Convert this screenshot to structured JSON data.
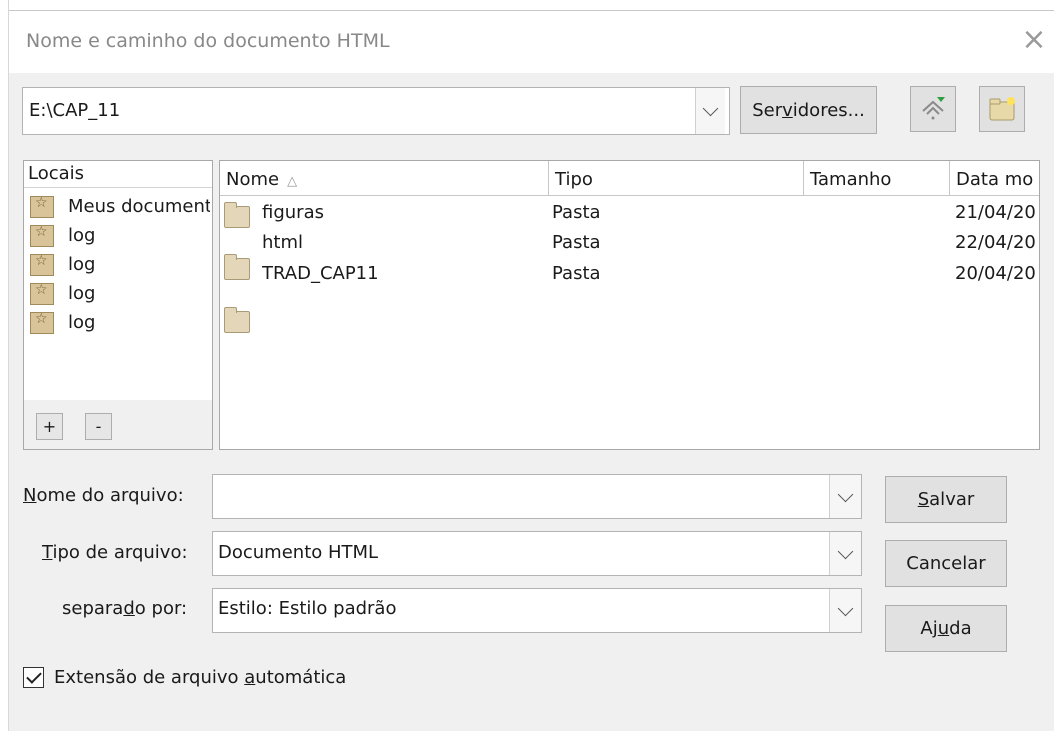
{
  "window": {
    "title": "Nome e caminho do documento HTML",
    "close_glyph": "×"
  },
  "path": {
    "value": "E:\\CAP_11"
  },
  "toolbar": {
    "servers_label": "Servidores...",
    "servers_label_pre": "Ser",
    "servers_label_mnemonic": "v",
    "servers_label_post": "idores...",
    "up_icon": "level-up-icon",
    "new_folder_icon": "new-folder-icon"
  },
  "places": {
    "header": "Locais",
    "items": [
      {
        "label": "Meus documentos"
      },
      {
        "label": "log"
      },
      {
        "label": "log"
      },
      {
        "label": "log"
      },
      {
        "label": "log"
      }
    ],
    "add_label": "+",
    "remove_label": "-"
  },
  "files": {
    "columns": [
      "Nome",
      "Tipo",
      "Tamanho",
      "Data mo"
    ],
    "sort_indicator": "△",
    "rows": [
      {
        "name": "figuras",
        "type": "Pasta",
        "size": "",
        "date": "21/04/20"
      },
      {
        "name": "html",
        "type": "Pasta",
        "size": "",
        "date": "22/04/20"
      },
      {
        "name": "TRAD_CAP11",
        "type": "Pasta",
        "size": "",
        "date": "20/04/20"
      }
    ]
  },
  "form": {
    "filename_label_mn": "N",
    "filename_label_rest": "ome do arquivo:",
    "filename_value": "",
    "filetype_label_mn": "T",
    "filetype_label_rest": "ipo de arquivo:",
    "filetype_value": "Documento HTML",
    "separator_label_pre": "separa",
    "separator_label_mn": "d",
    "separator_label_post": "o por:",
    "separator_value": "Estilo: Estilo padrão"
  },
  "buttons": {
    "save_mn": "S",
    "save_rest": "alvar",
    "cancel": "Cancelar",
    "help_pre": "Aj",
    "help_mn": "u",
    "help_post": "da"
  },
  "auto_extension": {
    "checked": true,
    "label_pre": "Extensão de arquivo ",
    "label_mn": "a",
    "label_post": "utomática"
  }
}
